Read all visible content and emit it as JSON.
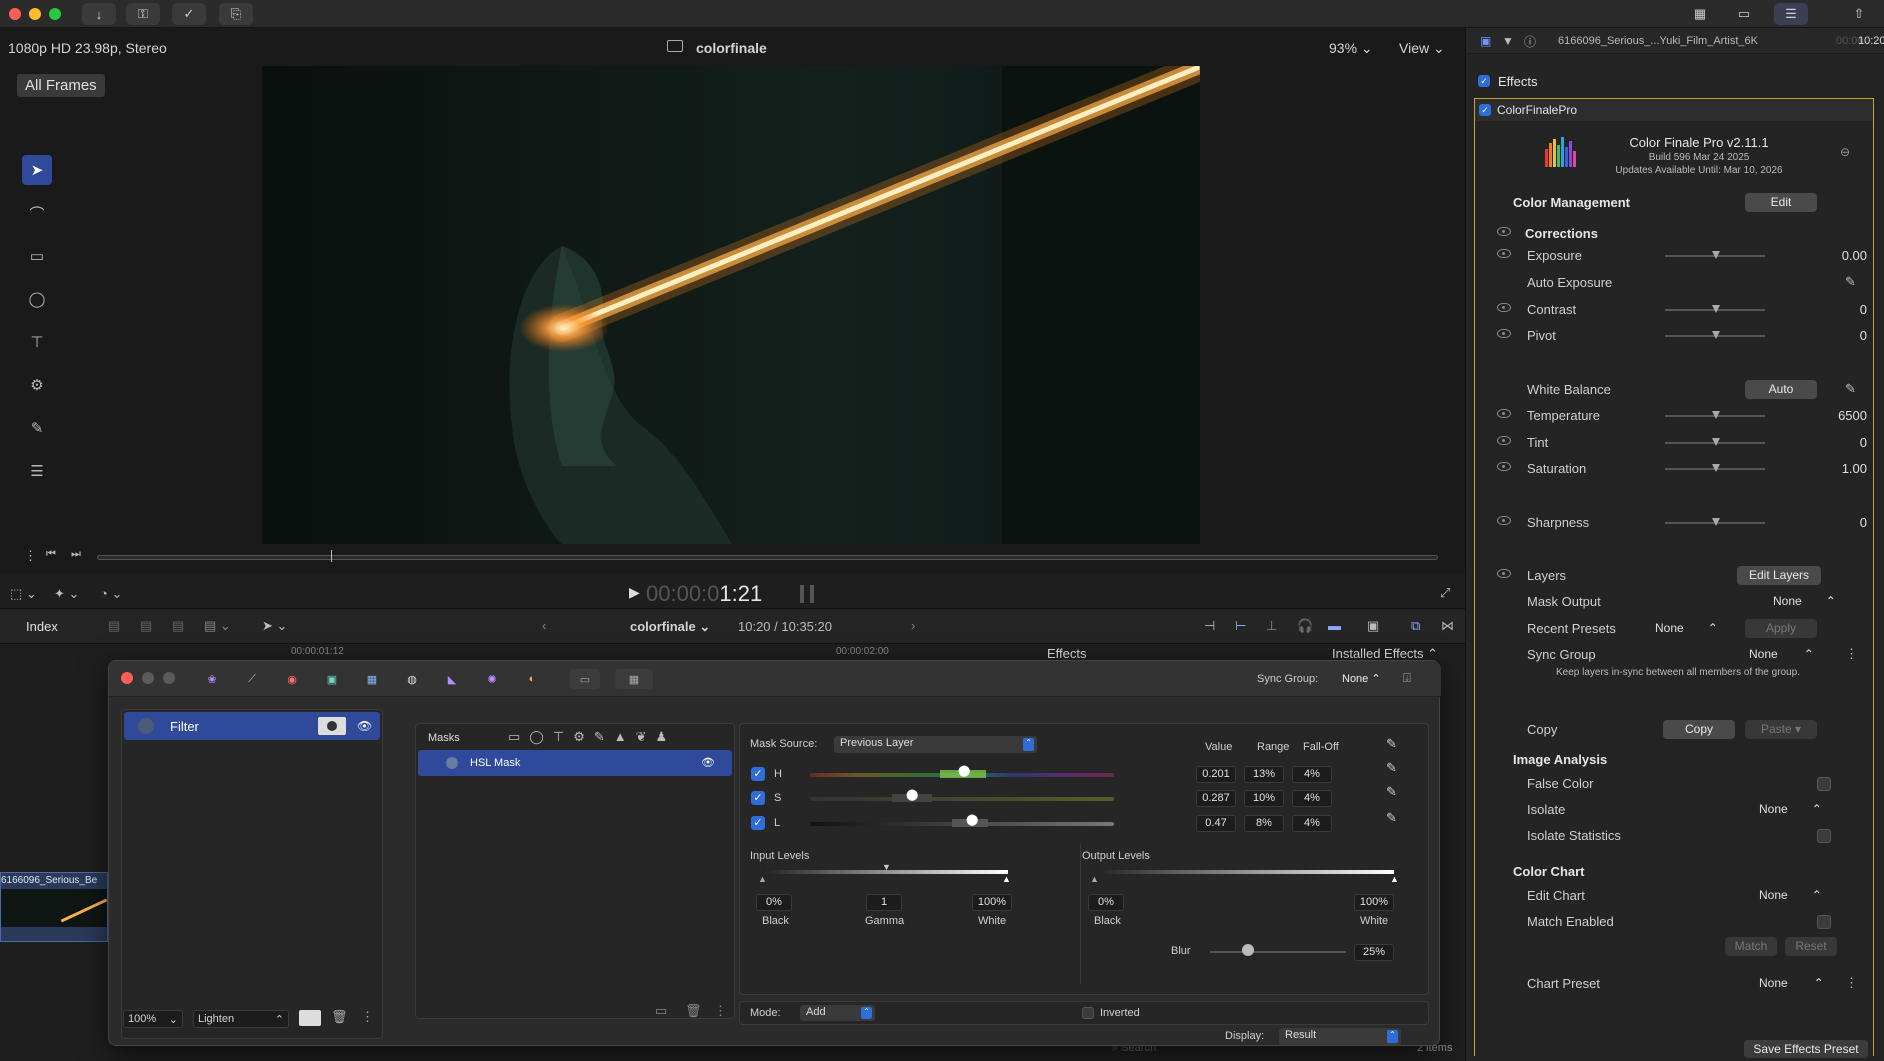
{
  "topbar": {
    "icons": [
      "download-icon",
      "key-icon",
      "checkmark-icon",
      "share-icon"
    ],
    "right_icons": [
      "grid-view-icon",
      "filmstrip-icon",
      "inspector-icon",
      "export-icon"
    ]
  },
  "viewer": {
    "format": "1080p HD 23.98p, Stereo",
    "title": "colorfinale",
    "zoom": "93%",
    "view": "View",
    "all_frames": "All Frames",
    "timecode_dim": "00:00:0",
    "timecode": "1:21"
  },
  "timeline": {
    "index": "Index",
    "project": "colorfinale",
    "position": "10:20 / 10:35:20",
    "ruler1": "00:00:01:12",
    "ruler2": "00:00:02:00",
    "effects_tab": "Effects",
    "installed": "Installed Effects",
    "clip_name": "6166096_Serious_Be",
    "items": "2 items",
    "search": "Search"
  },
  "inspector": {
    "clip": "6166096_Serious_...Yuki_Film_Artist_6K",
    "tc_dim": "00:00",
    "tc": "10:20",
    "effects": "Effects",
    "plugin": "ColorFinalePro",
    "product": "Color Finale Pro v2.11.1",
    "build": "Build 596 Mar 24 2025",
    "updates": "Updates Available Until: Mar 10, 2026",
    "color_mgmt": "Color Management",
    "edit": "Edit",
    "corrections": "Corrections",
    "exposure": "Exposure",
    "exposure_v": "0.00",
    "auto_exposure": "Auto Exposure",
    "contrast": "Contrast",
    "contrast_v": "0",
    "pivot": "Pivot",
    "pivot_v": "0",
    "wb": "White Balance",
    "auto": "Auto",
    "temperature": "Temperature",
    "temperature_v": "6500",
    "tint": "Tint",
    "tint_v": "0",
    "saturation": "Saturation",
    "saturation_v": "1.00",
    "sharpness": "Sharpness",
    "sharpness_v": "0",
    "layers": "Layers",
    "edit_layers": "Edit Layers",
    "mask_output": "Mask Output",
    "mask_output_v": "None",
    "recent_presets": "Recent Presets",
    "recent_presets_v": "None",
    "apply": "Apply",
    "sync_group": "Sync Group",
    "sync_group_v": "None",
    "sync_note": "Keep layers in-sync between all members of the group.",
    "copy_label": "Copy",
    "copy_btn": "Copy",
    "paste_btn": "Paste",
    "image_analysis": "Image Analysis",
    "false_color": "False Color",
    "isolate": "Isolate",
    "isolate_v": "None",
    "isolate_stats": "Isolate Statistics",
    "color_chart": "Color Chart",
    "edit_chart": "Edit Chart",
    "edit_chart_v": "None",
    "match_enabled": "Match Enabled",
    "match": "Match",
    "reset": "Reset",
    "chart_preset": "Chart Preset",
    "chart_preset_v": "None",
    "save_preset": "Save Effects Preset"
  },
  "cf": {
    "sync_group": "Sync Group:",
    "sync_group_v": "None",
    "filter": "Filter",
    "zoom": "100%",
    "blend": "Lighten",
    "masks": "Masks",
    "hsl_mask": "HSL Mask",
    "mask_source": "Mask Source:",
    "mask_source_v": "Previous Layer",
    "col_value": "Value",
    "col_range": "Range",
    "col_falloff": "Fall-Off",
    "h": "H",
    "h_value": "0.201",
    "h_range": "13%",
    "h_falloff": "4%",
    "s": "S",
    "s_value": "0.287",
    "s_range": "10%",
    "s_falloff": "4%",
    "l": "L",
    "l_value": "0.47",
    "l_range": "8%",
    "l_falloff": "4%",
    "input_levels": "Input Levels",
    "output_levels": "Output Levels",
    "in_black": "0%",
    "in_gamma": "1",
    "in_white": "100%",
    "out_black": "0%",
    "out_white": "100%",
    "black": "Black",
    "gamma": "Gamma",
    "white": "White",
    "blur": "Blur",
    "blur_v": "25%",
    "mode": "Mode:",
    "mode_v": "Add",
    "inverted": "Inverted",
    "display": "Display:",
    "display_v": "Result"
  },
  "colors": {
    "accent": "#2f6ed8",
    "gold": "#c9a227",
    "beam": "#ffb14a"
  }
}
